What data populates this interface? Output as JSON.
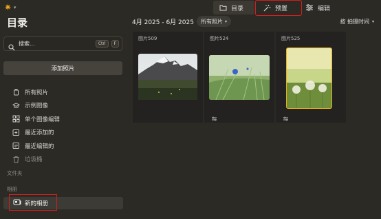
{
  "tabs": {
    "catalog": "目录",
    "preset": "预置",
    "edit": "编辑"
  },
  "sidebar": {
    "title": "目录",
    "search": {
      "placeholder": "搜索...",
      "kbd1": "Ctrl",
      "kbd2": "F"
    },
    "add_photos": "添加照片",
    "items": [
      {
        "label": "所有照片",
        "icon": "photo-stack-icon"
      },
      {
        "label": "示例图像",
        "icon": "graduation-cap-icon"
      },
      {
        "label": "单个图像编辑",
        "icon": "grid-icon"
      },
      {
        "label": "最近添加的",
        "icon": "recent-added-icon"
      },
      {
        "label": "最近编辑的",
        "icon": "recent-edited-icon"
      },
      {
        "label": "垃圾桶",
        "icon": "trash-icon"
      }
    ],
    "folders_header": "文件夹",
    "albums_header": "相册",
    "new_album": "新的相册"
  },
  "main": {
    "date_range": "4月 2025 - 6月 2025",
    "filter": "所有照片",
    "sort": "按 拍摄时间",
    "photos": [
      {
        "label": "图片509",
        "subject": "mountain-landscape"
      },
      {
        "label": "图片524",
        "subject": "cornflower-grass"
      },
      {
        "label": "图片525",
        "subject": "dandelions",
        "selected": true
      }
    ]
  },
  "colors": {
    "accent": "#e8b21a",
    "highlight_box": "#d21e1e",
    "background": "#2c2a25"
  }
}
